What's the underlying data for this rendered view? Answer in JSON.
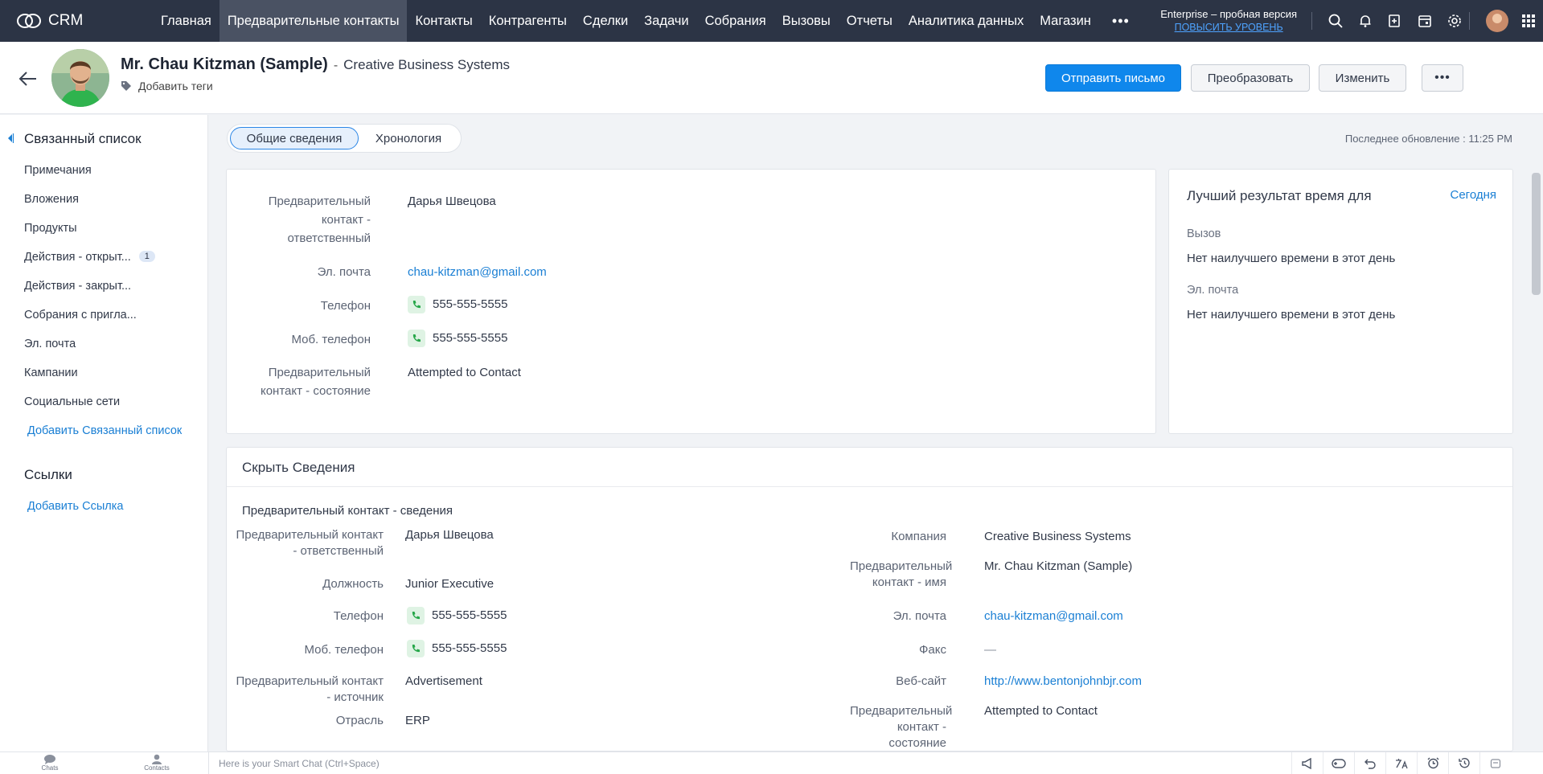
{
  "app": {
    "logo_text": "CRM"
  },
  "nav": {
    "items": [
      {
        "label": "Главная"
      },
      {
        "label": "Предварительные контакты"
      },
      {
        "label": "Контакты"
      },
      {
        "label": "Контрагенты"
      },
      {
        "label": "Сделки"
      },
      {
        "label": "Задачи"
      },
      {
        "label": "Собрания"
      },
      {
        "label": "Вызовы"
      },
      {
        "label": "Отчеты"
      },
      {
        "label": "Аналитика данных"
      },
      {
        "label": "Магазин"
      }
    ],
    "more": "•••",
    "plan_name": "Enterprise – пробная версия",
    "upgrade_label": "ПОВЫСИТЬ УРОВЕНЬ"
  },
  "record": {
    "name": "Mr. Chau Kitzman (Sample)",
    "dash": "-",
    "company": "Creative Business Systems",
    "add_tags": "Добавить теги",
    "actions": {
      "send_email": "Отправить письмо",
      "convert": "Преобразовать",
      "edit": "Изменить",
      "more": "•••"
    }
  },
  "sidebar": {
    "related_heading": "Связанный список",
    "items": [
      {
        "label": "Примечания"
      },
      {
        "label": "Вложения"
      },
      {
        "label": "Продукты"
      },
      {
        "label": "Действия - открыт...",
        "badge": "1"
      },
      {
        "label": "Действия - закрыт..."
      },
      {
        "label": "Собрания с пригла..."
      },
      {
        "label": "Эл. почта"
      },
      {
        "label": "Кампании"
      },
      {
        "label": "Социальные сети"
      }
    ],
    "add_related": "Добавить Связанный список",
    "links_heading": "Ссылки",
    "add_link": "Добавить Ссылка"
  },
  "tabs": {
    "overview": "Общие сведения",
    "timeline": "Хронология"
  },
  "last_updated": "Последнее обновление : 11:25 PM",
  "overview": {
    "owner_label": "Предварительный контакт - ответственный",
    "owner": "Дарья Швецова",
    "email_label": "Эл. почта",
    "email": "chau-kitzman@gmail.com",
    "phone_label": "Телефон",
    "phone": "555-555-5555",
    "mobile_label": "Моб. телефон",
    "mobile": "555-555-5555",
    "status_label": "Предварительный контакт - состояние",
    "status": "Attempted to Contact"
  },
  "best_time": {
    "title": "Лучший результат время для",
    "period": "Сегодня",
    "call_label": "Вызов",
    "call_value": "Нет наилучшего времени в этот день",
    "email_label": "Эл. почта",
    "email_value": "Нет наилучшего времени в этот день"
  },
  "details": {
    "title": "Скрыть Сведения",
    "section": "Предварительный контакт - сведения",
    "left": {
      "owner_label": "Предварительный контакт - ответственный",
      "owner": "Дарья Швецова",
      "title_label": "Должность",
      "title": "Junior Executive",
      "phone_label": "Телефон",
      "phone": "555-555-5555",
      "mobile_label": "Моб. телефон",
      "mobile": "555-555-5555",
      "source_label": "Предварительный контакт - источник",
      "source": "Advertisement",
      "industry_label": "Отрасль",
      "industry": "ERP"
    },
    "right": {
      "company_label": "Компания",
      "company": "Creative Business Systems",
      "name_label": "Предварительный контакт - имя",
      "name": "Mr. Chau Kitzman (Sample)",
      "email_label": "Эл. почта",
      "email": "chau-kitzman@gmail.com",
      "fax_label": "Факс",
      "fax": "—",
      "website_label": "Веб-сайт",
      "website": "http://www.bentonjohnbjr.com",
      "status_label": "Предварительный контакт - состояние",
      "status": "Attempted to Contact"
    }
  },
  "bottombar": {
    "chats": "Chats",
    "contacts": "Contacts",
    "smart_chat": "Here is your Smart Chat (Ctrl+Space)"
  },
  "colors": {
    "topbar": "#2c3445",
    "primary": "#0f87ec",
    "link": "#1a7fd4"
  }
}
